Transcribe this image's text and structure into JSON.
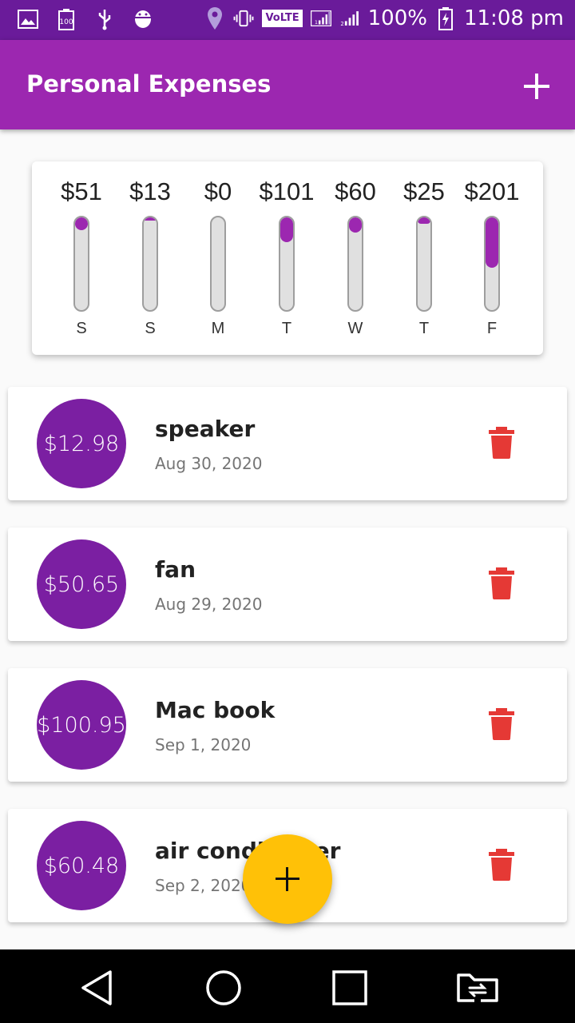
{
  "status_bar": {
    "left_icons": [
      "gallery-icon",
      "battery-saver-icon",
      "usb-icon",
      "android-debug-icon"
    ],
    "right_icons": [
      "location-icon",
      "vibrate-icon",
      "volte-icon",
      "signal-sim1-icon",
      "signal-sim2-icon",
      "battery-charging-icon"
    ],
    "volte": "VoLTE",
    "battery": "100%",
    "time": "11:08 pm"
  },
  "app_bar": {
    "title": "Personal Expenses",
    "add_icon": "plus-icon"
  },
  "chart": {
    "days": [
      {
        "label": "S",
        "amount": "$51",
        "fraction": 0.14
      },
      {
        "label": "S",
        "amount": "$13",
        "fraction": 0.035
      },
      {
        "label": "M",
        "amount": "$0",
        "fraction": 0
      },
      {
        "label": "T",
        "amount": "$101",
        "fraction": 0.27
      },
      {
        "label": "W",
        "amount": "$60",
        "fraction": 0.16
      },
      {
        "label": "T",
        "amount": "$25",
        "fraction": 0.067
      },
      {
        "label": "F",
        "amount": "$201",
        "fraction": 0.54
      }
    ]
  },
  "transactions": [
    {
      "amount": "$12.98",
      "title": "speaker",
      "date": "Aug 30, 2020"
    },
    {
      "amount": "$50.65",
      "title": "fan",
      "date": "Aug 29, 2020"
    },
    {
      "amount": "$100.95",
      "title": "Mac book",
      "date": "Sep 1, 2020"
    },
    {
      "amount": "$60.48",
      "title": "air conditioner",
      "date": "Sep 2, 2020"
    }
  ],
  "fab_icon": "plus-icon",
  "nav": [
    "back-icon",
    "home-icon",
    "recents-icon",
    "switch-sim-icon"
  ],
  "colors": {
    "primary": "#9c27b0",
    "primary_dark": "#6a1b9a",
    "avatar": "#7b1fa2",
    "accent": "#ffc107",
    "delete": "#e53935"
  }
}
